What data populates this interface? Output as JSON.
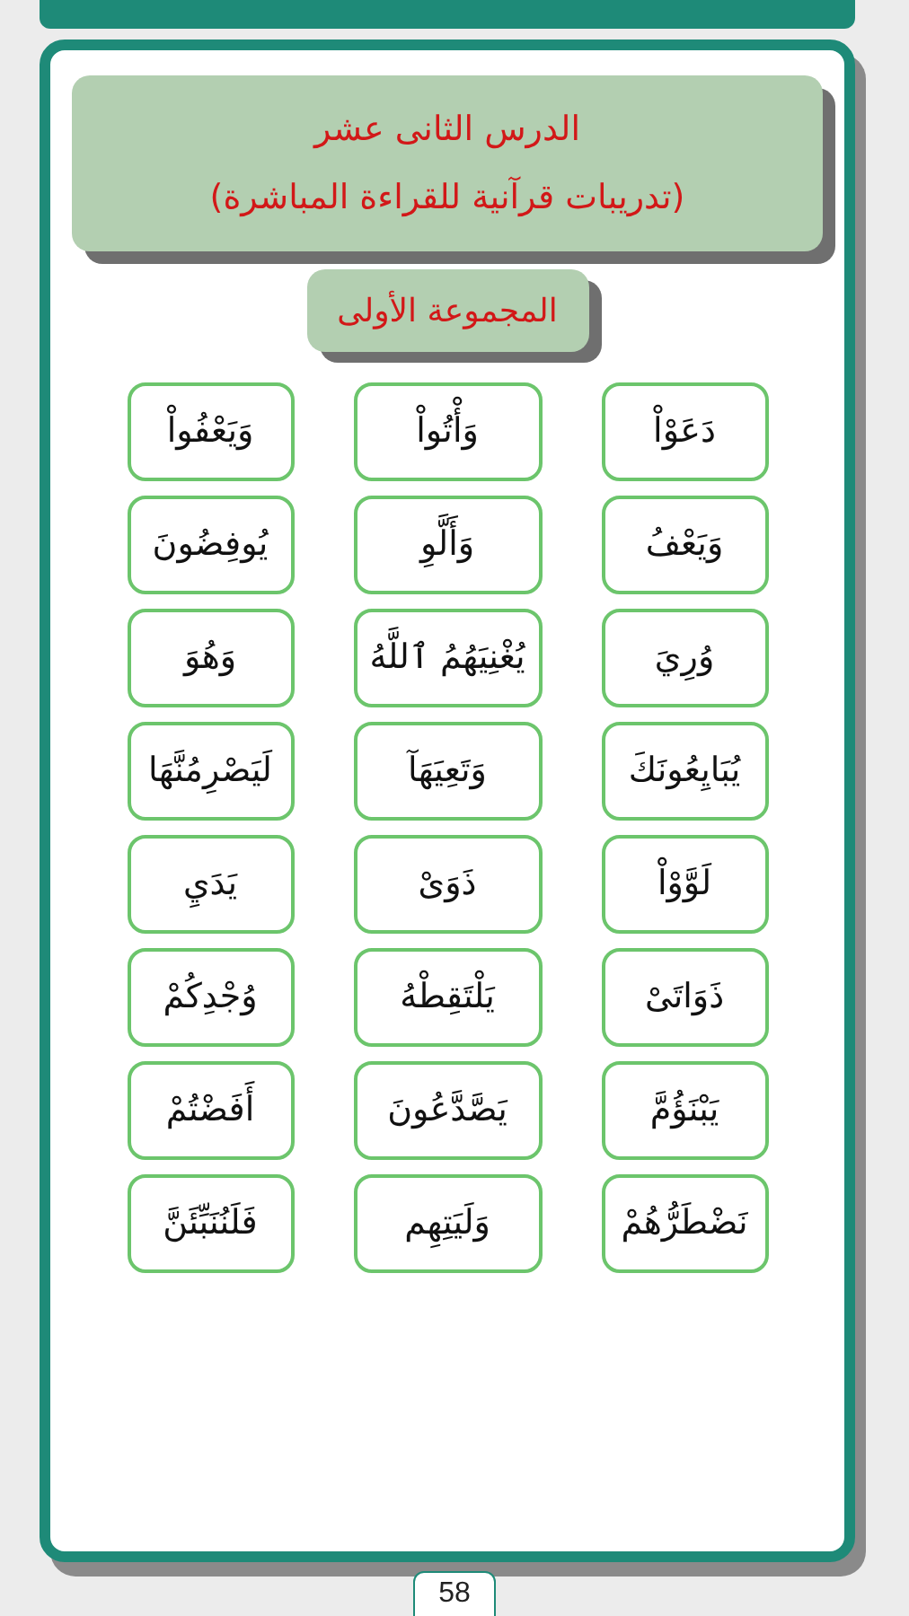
{
  "lesson_title": "الدرس الثانى عشر",
  "lesson_subtitle": "(تدريبات قرآنية للقراءة المباشرة)",
  "group_title": "المجموعة الأولى",
  "words": [
    "دَعَوْاْ",
    "وَأْتُواْ",
    "وَيَعْفُواْ",
    "وَيَعْفُ",
    "وَأَلَّوِ",
    "يُوفِضُونَ",
    "وُرِيَ",
    "يُغْنِيَهُمُ ٱللَّهُ",
    "وَهُوَ",
    "يُبَايِعُونَكَ",
    "وَتَعِيَهَآ",
    "لَيَصْرِمُنَّهَا",
    "لَوَّوْاْ",
    "ذَوَىْ",
    "يَدَيِ",
    "ذَوَاتَىْ",
    "يَلْتَقِطْهُ",
    "وُجْدِكُمْ",
    "يَبْنَؤُمَّ",
    "يَصَّدَّعُونَ",
    "أَفَضْتُمْ",
    "نَضْطَرُّهُمْ",
    "وَلَيَتِهِم",
    "فَلَنُنَبِّئَنَّ"
  ],
  "page_number": "58"
}
